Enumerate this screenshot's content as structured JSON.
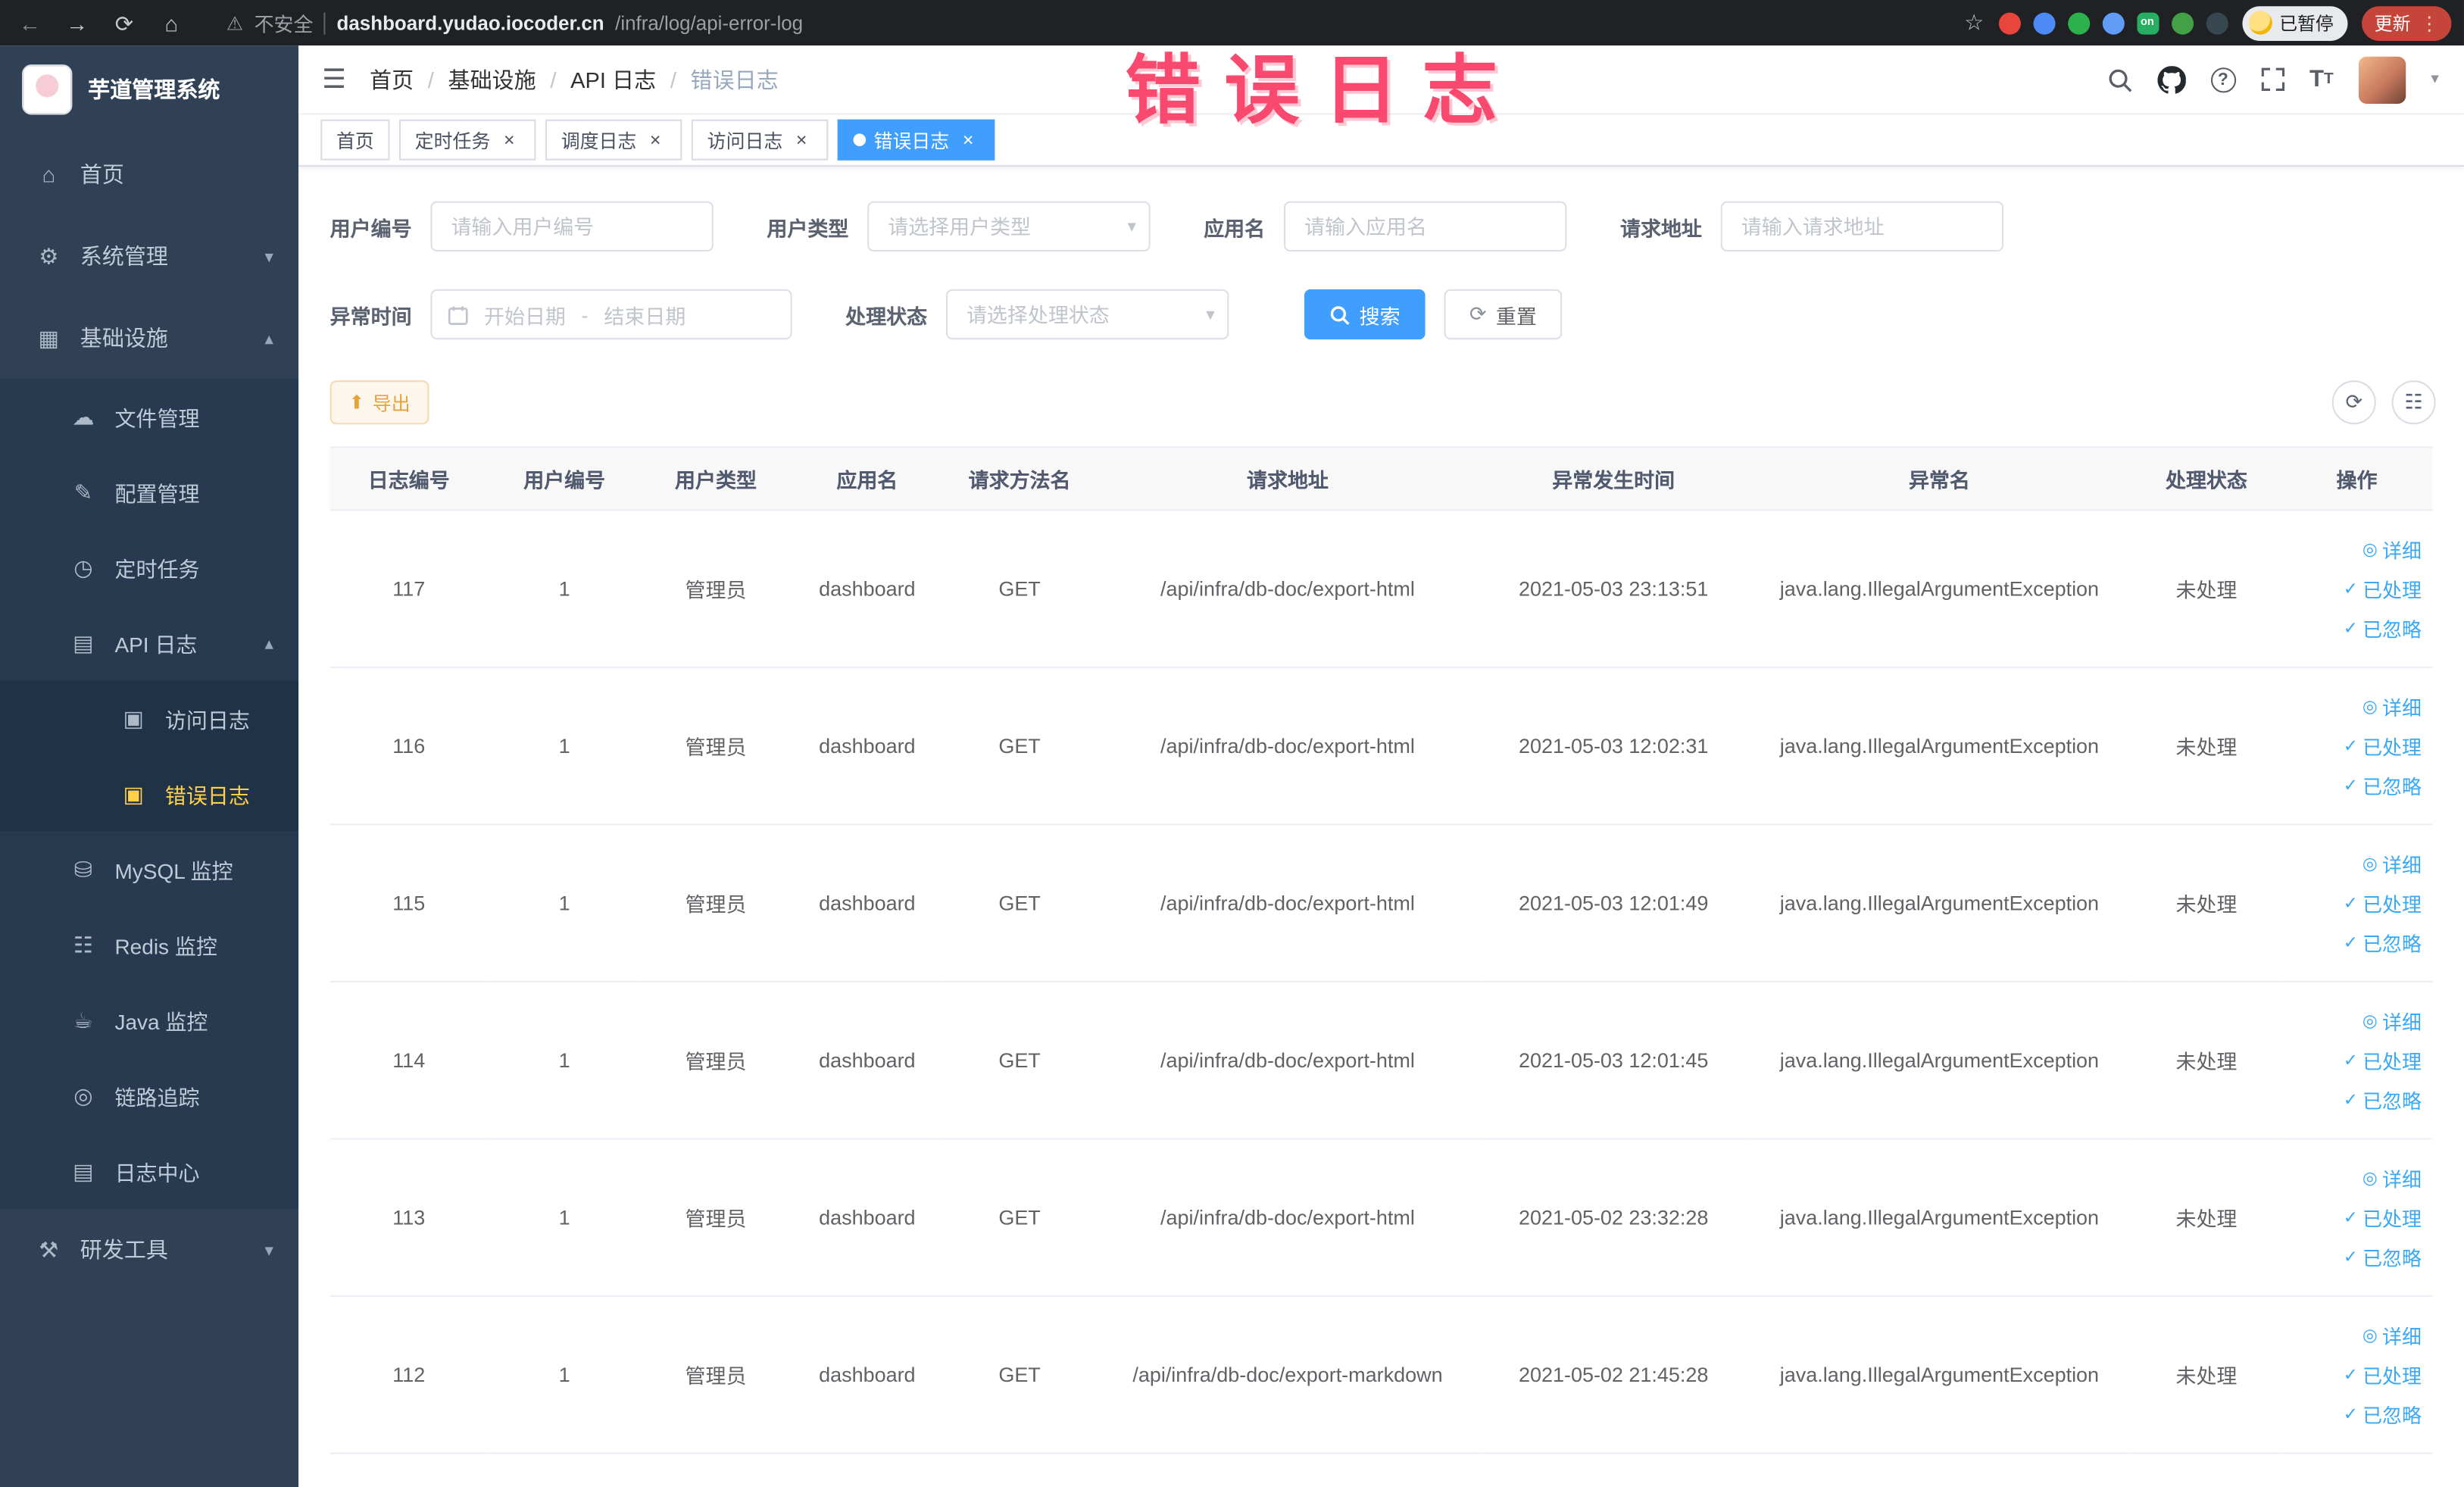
{
  "theme": {
    "primary": "#409eff",
    "link": "#3aa9f5",
    "warning_text": "#e6a23c",
    "warning_bg": "#fdf6ec",
    "warning_border": "#f5dab1",
    "sidebar_bg": "#304156",
    "sub_bg": "#273a4f",
    "sub2_bg": "#203246",
    "active_text": "#ffd04b",
    "annotation": "#fa3a62"
  },
  "icons": {
    "back": "←",
    "forward": "→",
    "reload": "⟳",
    "home": "⌂",
    "warning": "⚠",
    "star": "☆",
    "kebab": "⋮",
    "hamburger": "☰",
    "chevron_down": "▾",
    "chevron_up": "▴",
    "close": "×",
    "refresh": "⟳",
    "columns": "☷",
    "help": "?",
    "font_size_big": "T",
    "font_size_small": "T",
    "export": "⬆"
  },
  "browser": {
    "security_label": "不安全",
    "url_host": "dashboard.yudao.iocoder.cn",
    "url_path": "/infra/log/api-error-log",
    "extensions": [
      {
        "name": "extension-red",
        "color": "#e8453c",
        "label": ""
      },
      {
        "name": "extension-blue",
        "color": "#4c8bf5",
        "label": ""
      },
      {
        "name": "extension-green-circle",
        "color": "#2bb24c",
        "label": ""
      },
      {
        "name": "extension-grid",
        "color": "#5f9df7",
        "label": ""
      },
      {
        "name": "extension-on-badge",
        "color": "#27ae60",
        "label": "on"
      },
      {
        "name": "extension-leaf",
        "color": "#43a047",
        "label": ""
      },
      {
        "name": "extension-dark",
        "color": "#37474f",
        "label": ""
      }
    ],
    "profile_chip": "已暂停",
    "update_button": "更新"
  },
  "annotation": {
    "text": "错误日志"
  },
  "sidebar": {
    "title": "芋道管理系统",
    "items": [
      {
        "key": "home",
        "label": "首页",
        "icon": "home",
        "level": "top"
      },
      {
        "key": "system-mgmt",
        "label": "系统管理",
        "icon": "system",
        "level": "top",
        "arrow": "down"
      },
      {
        "key": "infrastructure",
        "label": "基础设施",
        "icon": "infra",
        "level": "top",
        "arrow": "up"
      },
      {
        "key": "file-mgmt",
        "label": "文件管理",
        "icon": "file",
        "level": "sub"
      },
      {
        "key": "config-mgmt",
        "label": "配置管理",
        "icon": "config",
        "level": "sub"
      },
      {
        "key": "scheduled-task",
        "label": "定时任务",
        "icon": "timer",
        "level": "sub"
      },
      {
        "key": "api-log",
        "label": "API 日志",
        "icon": "api",
        "level": "sub",
        "arrow": "up"
      },
      {
        "key": "access-log",
        "label": "访问日志",
        "icon": "log",
        "level": "sub2"
      },
      {
        "key": "error-log",
        "label": "错误日志",
        "icon": "log",
        "level": "sub2",
        "active": true
      },
      {
        "key": "mysql-monitor",
        "label": "MySQL 监控",
        "icon": "mysql",
        "level": "sub"
      },
      {
        "key": "redis-monitor",
        "label": "Redis 监控",
        "icon": "redis",
        "level": "sub"
      },
      {
        "key": "java-monitor",
        "label": "Java 监控",
        "icon": "java",
        "level": "sub"
      },
      {
        "key": "link-trace",
        "label": "链路追踪",
        "icon": "trace",
        "level": "sub"
      },
      {
        "key": "log-center",
        "label": "日志中心",
        "icon": "center",
        "level": "sub"
      },
      {
        "key": "dev-tools",
        "label": "研发工具",
        "icon": "tools",
        "level": "top",
        "arrow": "down"
      }
    ]
  },
  "header": {
    "breadcrumbs": [
      "首页",
      "基础设施",
      "API 日志",
      "错误日志"
    ],
    "breadcrumb_separator": "/"
  },
  "tabs": [
    {
      "key": "home",
      "label": "首页",
      "closable": false,
      "active": false
    },
    {
      "key": "scheduled-task",
      "label": "定时任务",
      "closable": true,
      "active": false
    },
    {
      "key": "schedule-log",
      "label": "调度日志",
      "closable": true,
      "active": false
    },
    {
      "key": "access-log",
      "label": "访问日志",
      "closable": true,
      "active": false
    },
    {
      "key": "error-log",
      "label": "错误日志",
      "closable": true,
      "active": true
    }
  ],
  "filters": {
    "user_id": {
      "label": "用户编号",
      "placeholder": "请输入用户编号"
    },
    "user_type": {
      "label": "用户类型",
      "placeholder": "请选择用户类型"
    },
    "app_name": {
      "label": "应用名",
      "placeholder": "请输入应用名"
    },
    "request_url": {
      "label": "请求地址",
      "placeholder": "请输入请求地址"
    },
    "exception_time": {
      "label": "异常时间",
      "start_placeholder": "开始日期",
      "separator": "-",
      "end_placeholder": "结束日期"
    },
    "process_status": {
      "label": "处理状态",
      "placeholder": "请选择处理状态"
    },
    "search_label": "搜索",
    "reset_label": "重置"
  },
  "toolbar": {
    "export_label": "导出"
  },
  "table": {
    "headers": [
      "日志编号",
      "用户编号",
      "用户类型",
      "应用名",
      "请求方法名",
      "请求地址",
      "异常发生时间",
      "异常名",
      "处理状态",
      "操作"
    ],
    "actions": [
      "详细",
      "已处理",
      "已忽略"
    ],
    "action_icons": [
      "◎",
      "✓",
      "✓"
    ],
    "rows": [
      {
        "id": "117",
        "user_id": "1",
        "user_type": "管理员",
        "app": "dashboard",
        "method": "GET",
        "url": "/api/infra/db-doc/export-html",
        "time": "2021-05-03 23:13:51",
        "exception": "java.lang.IllegalArgumentException",
        "status": "未处理"
      },
      {
        "id": "116",
        "user_id": "1",
        "user_type": "管理员",
        "app": "dashboard",
        "method": "GET",
        "url": "/api/infra/db-doc/export-html",
        "time": "2021-05-03 12:02:31",
        "exception": "java.lang.IllegalArgumentException",
        "status": "未处理"
      },
      {
        "id": "115",
        "user_id": "1",
        "user_type": "管理员",
        "app": "dashboard",
        "method": "GET",
        "url": "/api/infra/db-doc/export-html",
        "time": "2021-05-03 12:01:49",
        "exception": "java.lang.IllegalArgumentException",
        "status": "未处理"
      },
      {
        "id": "114",
        "user_id": "1",
        "user_type": "管理员",
        "app": "dashboard",
        "method": "GET",
        "url": "/api/infra/db-doc/export-html",
        "time": "2021-05-03 12:01:45",
        "exception": "java.lang.IllegalArgumentException",
        "status": "未处理"
      },
      {
        "id": "113",
        "user_id": "1",
        "user_type": "管理员",
        "app": "dashboard",
        "method": "GET",
        "url": "/api/infra/db-doc/export-html",
        "time": "2021-05-02 23:32:28",
        "exception": "java.lang.IllegalArgumentException",
        "status": "未处理"
      },
      {
        "id": "112",
        "user_id": "1",
        "user_type": "管理员",
        "app": "dashboard",
        "method": "GET",
        "url": "/api/infra/db-doc/export-markdown",
        "time": "2021-05-02 21:45:28",
        "exception": "java.lang.IllegalArgumentException",
        "status": "未处理"
      }
    ]
  }
}
